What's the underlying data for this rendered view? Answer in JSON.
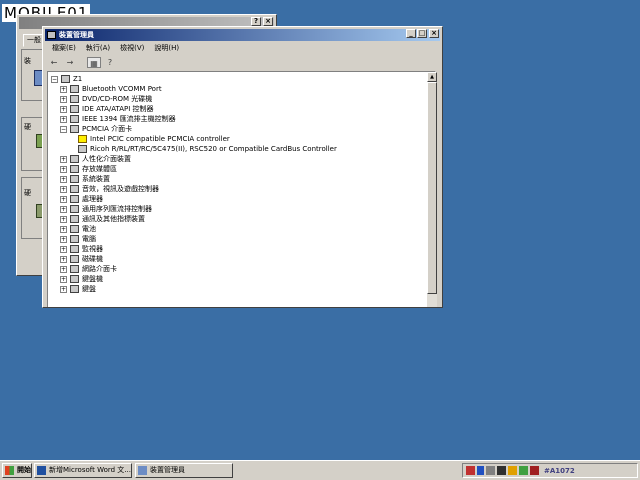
{
  "watermark": {
    "text": "MOBILE01"
  },
  "background_dialog": {
    "help_label": "?",
    "close_label": "×",
    "tab_general": "一般",
    "group1": "裝",
    "group2": "硬",
    "group3": "硬"
  },
  "device_manager": {
    "title": "裝置管理員",
    "min_label": "_",
    "max_label": "□",
    "close_label": "×",
    "menu": [
      {
        "label": "檔案(E)"
      },
      {
        "label": "執行(A)"
      },
      {
        "label": "檢視(V)"
      },
      {
        "label": "說明(H)"
      }
    ],
    "toolbar": {
      "back_label": "←",
      "forward_label": "→",
      "props_label": "▦",
      "help_label": "?"
    },
    "tree": {
      "root": "Z1",
      "items": [
        {
          "label": "Bluetooth VCOMM Port",
          "expander": "+"
        },
        {
          "label": "DVD/CD-ROM 光碟機",
          "expander": "+"
        },
        {
          "label": "IDE ATA/ATAPI 控制器",
          "expander": "+"
        },
        {
          "label": "IEEE 1394 匯流排主機控制器",
          "expander": "+"
        },
        {
          "label": "PCMCIA 介面卡",
          "expander": "−"
        },
        {
          "label": "Intel PCIC compatible PCMCIA controller",
          "child": true,
          "warn": true
        },
        {
          "label": "Ricoh R/RL/RT/RC/5C475(II), RSC520 or Compatible CardBus Controller",
          "child": true
        },
        {
          "label": "人性化介面裝置",
          "expander": "+"
        },
        {
          "label": "存放媒體區",
          "expander": "+"
        },
        {
          "label": "系統裝置",
          "expander": "+"
        },
        {
          "label": "音效，視訊及遊戲控制器",
          "expander": "+"
        },
        {
          "label": "處理器",
          "expander": "+"
        },
        {
          "label": "通用序列匯流排控制器",
          "expander": "+"
        },
        {
          "label": "通訊及其他指標裝置",
          "expander": "+"
        },
        {
          "label": "電池",
          "expander": "+"
        },
        {
          "label": "電腦",
          "expander": "+"
        },
        {
          "label": "監視器",
          "expander": "+"
        },
        {
          "label": "磁碟機",
          "expander": "+"
        },
        {
          "label": "網路介面卡",
          "expander": "+"
        },
        {
          "label": "鍵盤機",
          "expander": "+"
        },
        {
          "label": "鍵盤",
          "expander": "+"
        }
      ]
    }
  },
  "taskbar": {
    "start_label": "開始",
    "buttons": [
      {
        "label": "新增Microsoft Word 文..."
      },
      {
        "label": "裝置管理員"
      }
    ],
    "tray_text": "#A1072"
  }
}
